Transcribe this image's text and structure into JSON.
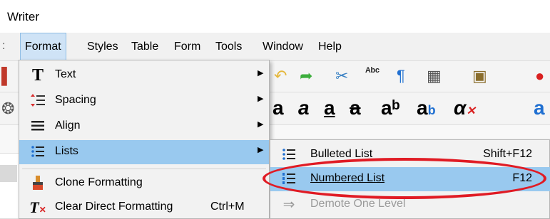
{
  "window": {
    "title": "Writer"
  },
  "menubar": {
    "items": [
      {
        "label": "Format",
        "active": true
      },
      {
        "label": "Styles"
      },
      {
        "label": "Table"
      },
      {
        "label": "Form"
      },
      {
        "label": "Tools"
      },
      {
        "label": "Window"
      },
      {
        "label": "Help"
      }
    ]
  },
  "format_menu": {
    "items": [
      {
        "label": "Text",
        "icon": "text-T-icon",
        "submenu": true
      },
      {
        "label": "Spacing",
        "icon": "spacing-icon",
        "submenu": true
      },
      {
        "label": "Align",
        "icon": "align-icon",
        "submenu": true
      },
      {
        "label": "Lists",
        "icon": "lists-icon",
        "submenu": true,
        "highlighted": true
      },
      {
        "label": "Clone Formatting",
        "icon": "clone-brush-icon"
      },
      {
        "label": "Clear Direct Formatting",
        "icon": "clear-formatting-icon",
        "shortcut": "Ctrl+M"
      }
    ]
  },
  "lists_submenu": {
    "items": [
      {
        "label": "Bulleted List",
        "icon": "bulleted-list-icon",
        "shortcut": "Shift+F12"
      },
      {
        "label": "Numbered List",
        "icon": "numbered-list-icon",
        "shortcut": "F12",
        "highlighted": true
      },
      {
        "label": "Demote One Level",
        "icon": "demote-arrow-icon",
        "disabled": true
      }
    ]
  },
  "colors": {
    "highlight": "#99c9ef",
    "annotation": "#e01b24",
    "menu_bg": "#f2f2f2"
  }
}
